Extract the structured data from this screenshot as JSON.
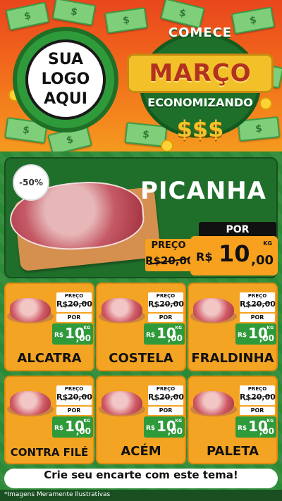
{
  "header": {
    "logo_lines": [
      "SUA",
      "LOGO",
      "AQUI"
    ],
    "promo": {
      "line1": "COMECE",
      "line2": "MARÇO",
      "line3": "ECONOMIZANDO",
      "line4": "$$$"
    }
  },
  "featured": {
    "discount": "-50%",
    "name": "PICANHA",
    "old_label": "PREÇO",
    "old_value": "R$20,00",
    "new_label": "POR",
    "currency": "R$",
    "new_int": "10",
    "new_dec": ",00",
    "unit": "KG"
  },
  "products": [
    {
      "name": "ALCATRA",
      "old_label": "PREÇO",
      "old_value": "R$20,00",
      "new_label": "POR",
      "currency": "R$",
      "new_int": "10",
      "new_dec": ",00",
      "unit": "KG"
    },
    {
      "name": "COSTELA",
      "old_label": "PREÇO",
      "old_value": "R$20,00",
      "new_label": "POR",
      "currency": "R$",
      "new_int": "10",
      "new_dec": ",00",
      "unit": "KG"
    },
    {
      "name": "FRALDINHA",
      "old_label": "PREÇO",
      "old_value": "R$20,00",
      "new_label": "POR",
      "currency": "R$",
      "new_int": "10",
      "new_dec": ",00",
      "unit": "KG"
    },
    {
      "name": "CONTRA FILÉ",
      "old_label": "PREÇO",
      "old_value": "R$20,00",
      "new_label": "POR",
      "currency": "R$",
      "new_int": "10",
      "new_dec": ",00",
      "unit": "KG"
    },
    {
      "name": "ACÉM",
      "old_label": "PREÇO",
      "old_value": "R$20,00",
      "new_label": "POR",
      "currency": "R$",
      "new_int": "10",
      "new_dec": ",00",
      "unit": "KG"
    },
    {
      "name": "PALETA",
      "old_label": "PREÇO",
      "old_value": "R$20,00",
      "new_label": "POR",
      "currency": "R$",
      "new_int": "10",
      "new_dec": ",00",
      "unit": "KG"
    }
  ],
  "footer": {
    "cta": "Crie seu encarte com este tema!",
    "disclaimer": "*Imagens Meramente Ilustrativas"
  },
  "colors": {
    "header_top": "#e9461d",
    "header_bottom": "#f59a1e",
    "green": "#2c8a36",
    "orange": "#f3a422"
  }
}
